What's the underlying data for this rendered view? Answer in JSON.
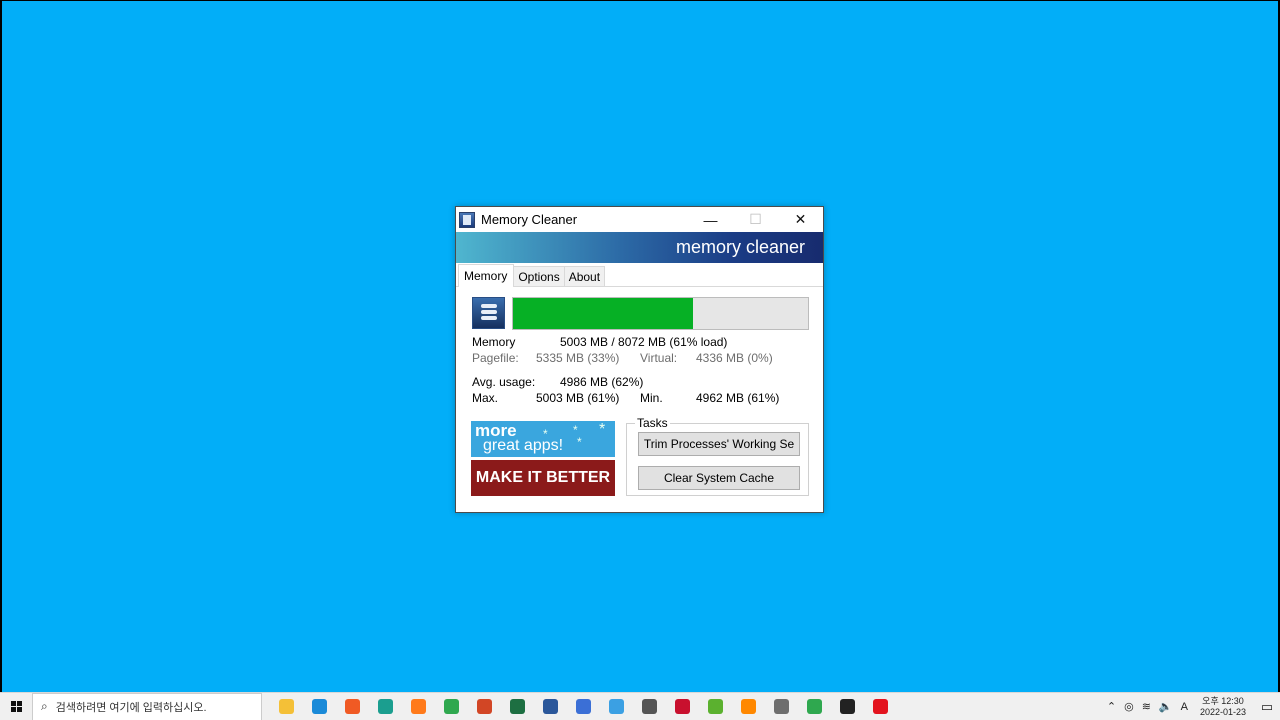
{
  "window": {
    "title": "Memory Cleaner",
    "banner": "memory cleaner",
    "controls": {
      "minimize": "—",
      "maximize": "☐",
      "close": "✕"
    }
  },
  "tabs": [
    {
      "label": "Memory",
      "active": true
    },
    {
      "label": "Options",
      "active": false
    },
    {
      "label": "About",
      "active": false
    }
  ],
  "memory": {
    "load_percent": 61,
    "memory_label": "Memory",
    "memory_value": "5003 MB / 8072 MB  (61% load)",
    "pagefile_label": "Pagefile:",
    "pagefile_value": "5335 MB (33%)",
    "virtual_label": "Virtual:",
    "virtual_value": "4336 MB (0%)",
    "avg_label": "Avg. usage:",
    "avg_value": "4986 MB (62%)",
    "max_label": "Max.",
    "max_value": "5003 MB (61%)",
    "min_label": "Min.",
    "min_value": "4962 MB (61%)"
  },
  "promo": {
    "line1": "more",
    "line2": "great apps!",
    "make_better": "MAKE IT BETTER"
  },
  "tasks": {
    "legend": "Tasks",
    "trim_button": "Trim Processes' Working Se",
    "clear_button": "Clear System Cache"
  },
  "taskbar": {
    "search_placeholder": "검색하려면 여기에 입력하십시오.",
    "apps": [
      {
        "name": "file-explorer-icon",
        "color": "#f4c037"
      },
      {
        "name": "edge-icon",
        "color": "#1a8ad8"
      },
      {
        "name": "brave-icon",
        "color": "#f05a24"
      },
      {
        "name": "app-teal-icon",
        "color": "#1b9e8f"
      },
      {
        "name": "firefox-icon",
        "color": "#ff7a1a"
      },
      {
        "name": "chrome-icon",
        "color": "#2fa84f"
      },
      {
        "name": "powerpoint-icon",
        "color": "#d24625"
      },
      {
        "name": "excel-icon",
        "color": "#1d6f42"
      },
      {
        "name": "word-icon",
        "color": "#2b579a"
      },
      {
        "name": "hwp-icon",
        "color": "#3b6fd6"
      },
      {
        "name": "remote-desktop-icon",
        "color": "#3ba0e3"
      },
      {
        "name": "magnifier-icon",
        "color": "#555555"
      },
      {
        "name": "app-red-icon",
        "color": "#c8102e"
      },
      {
        "name": "app-green-icon",
        "color": "#5bb12f"
      },
      {
        "name": "vlc-icon",
        "color": "#ff8800"
      },
      {
        "name": "calculator-icon",
        "color": "#6e6e6e"
      },
      {
        "name": "chrome-icon-2",
        "color": "#2fa84f"
      },
      {
        "name": "sticky-notes-icon",
        "color": "#222222"
      },
      {
        "name": "opera-icon",
        "color": "#e3131e"
      }
    ],
    "ime": "A",
    "clock_ampm_time": "오후 12:30",
    "clock_date": "2022-01-23"
  }
}
